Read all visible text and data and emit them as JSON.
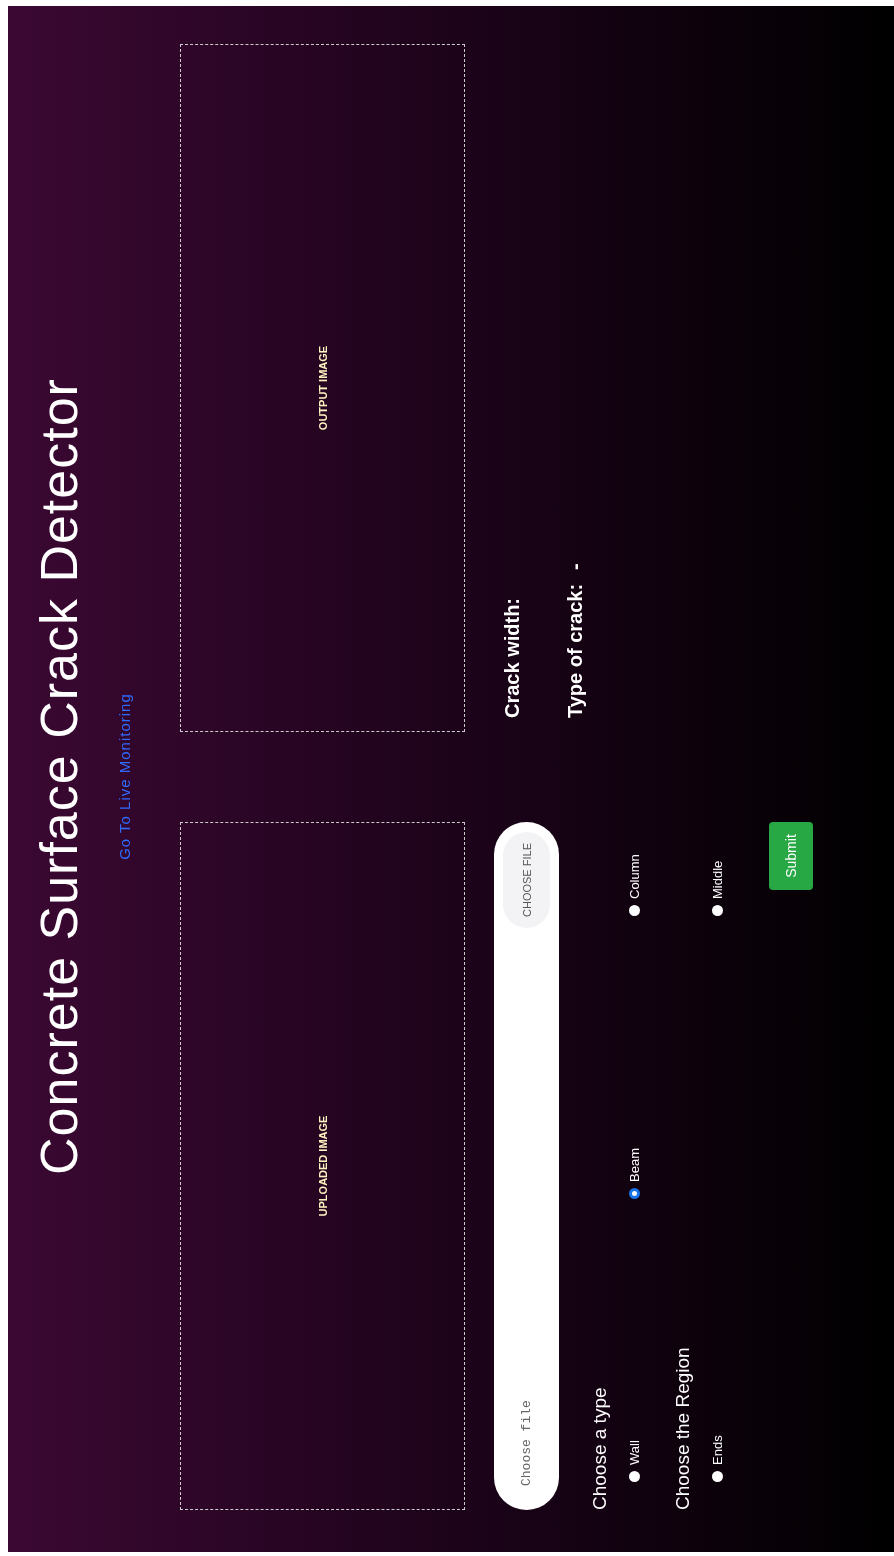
{
  "title": "Concrete Surface Crack Detector",
  "link": "Go To Live Monitoring",
  "uploaded_box": {
    "label": "UPLOADED IMAGE"
  },
  "output_box": {
    "label": "OUTPUT IMAGE"
  },
  "file_input": {
    "placeholder": "Choose file",
    "button": "CHOOSE FILE"
  },
  "type_group": {
    "label": "Choose a type",
    "options": [
      {
        "label": "Wall",
        "selected": false
      },
      {
        "label": "Beam",
        "selected": true
      },
      {
        "label": "Column",
        "selected": false
      }
    ]
  },
  "region_group": {
    "label": "Choose the Region",
    "options": [
      {
        "label": "Ends",
        "selected": false
      },
      {
        "label": "Middle",
        "selected": false
      }
    ]
  },
  "submit": "Submit",
  "results": [
    {
      "label": "Crack width:"
    },
    {
      "label": "Type of crack:",
      "value": "-"
    }
  ]
}
